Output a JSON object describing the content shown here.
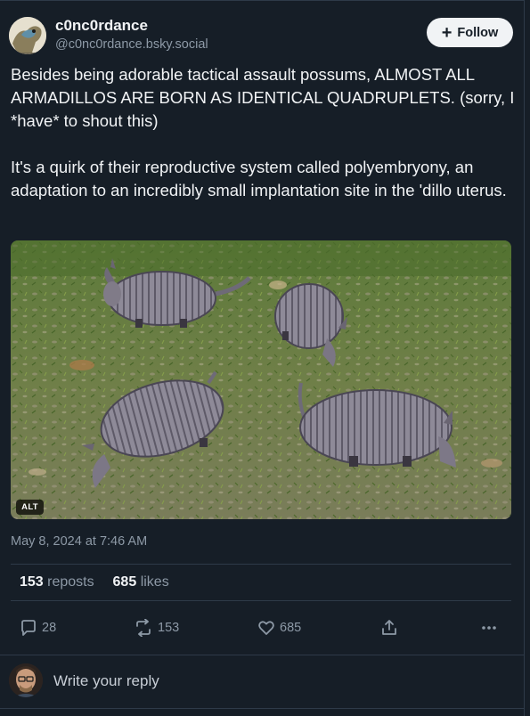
{
  "author": {
    "display_name": "c0nc0rdance",
    "handle": "@c0nc0rdance.bsky.social"
  },
  "follow_button": {
    "icon": "plus-icon",
    "label": "Follow"
  },
  "post": {
    "paragraphs": [
      "Besides being adorable tactical assault possums, ALMOST ALL ARMADILLOS ARE BORN AS IDENTICAL QUADRUPLETS. (sorry, I *have* to shout this)",
      "It's a quirk of their reproductive system called polyembryony, an adaptation to an incredibly small implantation site in the 'dillo uterus."
    ],
    "image_alt_badge": "ALT",
    "timestamp": "May 8, 2024 at 7:46 AM"
  },
  "stats": {
    "reposts_count": "153",
    "reposts_label": "reposts",
    "likes_count": "685",
    "likes_label": "likes"
  },
  "actions": {
    "reply": {
      "icon": "comment-icon",
      "count": "28"
    },
    "repost": {
      "icon": "repost-icon",
      "count": "153"
    },
    "like": {
      "icon": "heart-icon",
      "count": "685"
    },
    "share": {
      "icon": "share-icon"
    },
    "more": {
      "icon": "more-icon"
    }
  },
  "reply_box": {
    "placeholder": "Write your reply"
  },
  "colors": {
    "background": "#161e27",
    "text": "#f1f3f5",
    "muted": "#8d99a6",
    "border": "#2e3a48"
  }
}
